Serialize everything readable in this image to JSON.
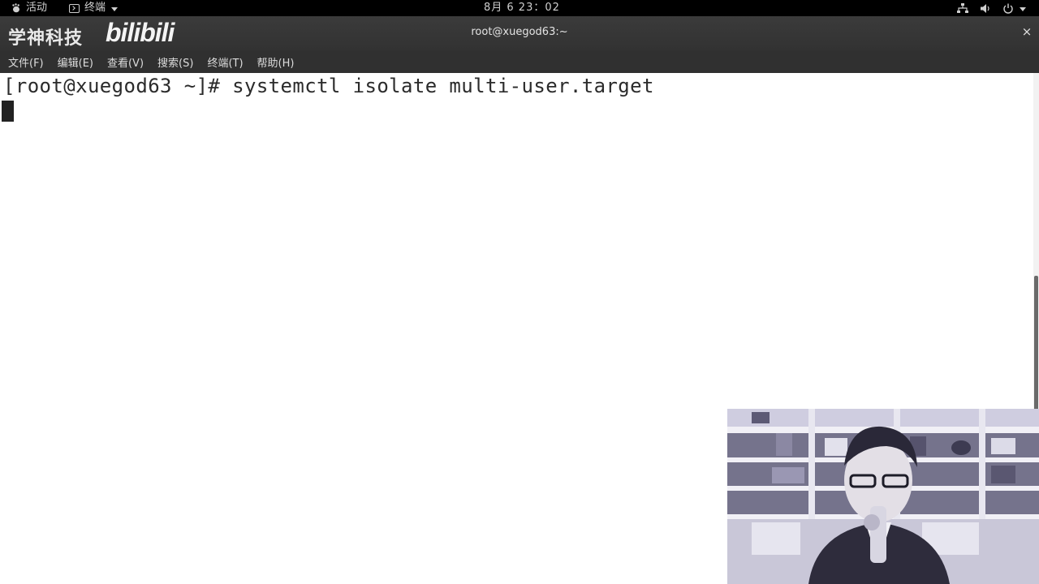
{
  "topbar": {
    "activities": "活动",
    "app_menu": "终端",
    "clock": "8月 6  23：02",
    "tray_icons": [
      "network-icon",
      "volume-icon",
      "power-icon"
    ]
  },
  "watermark": {
    "channel": "学神科技",
    "brand": "bilibili"
  },
  "window": {
    "title": "root@xuegod63:~",
    "close": "×"
  },
  "menu": {
    "file": "文件(F)",
    "edit": "编辑(E)",
    "view": "查看(V)",
    "search": "搜索(S)",
    "terminal": "终端(T)",
    "help": "帮助(H)"
  },
  "terminal": {
    "line1": "[root@xuegod63 ~]# systemctl isolate multi-user.target"
  },
  "colors": {
    "topbar_bg": "#000000",
    "titlebar_bg": "#353535",
    "menubar_bg": "#303030",
    "terminal_bg": "#ffffff",
    "terminal_fg": "#2b2b2b"
  }
}
